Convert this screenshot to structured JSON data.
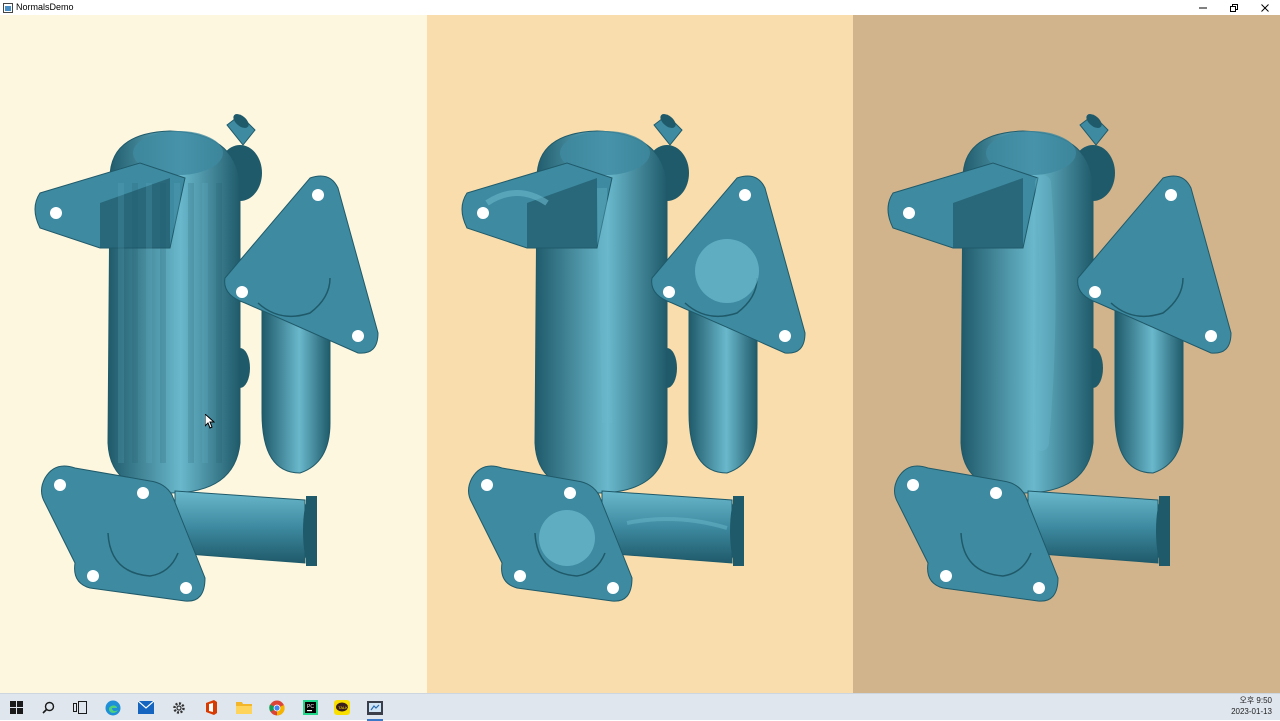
{
  "window": {
    "title": "NormalsDemo"
  },
  "panes": [
    {
      "name": "flat-shaded",
      "background": "#fef7e0"
    },
    {
      "name": "bumpy-normals",
      "background": "#f9ddac"
    },
    {
      "name": "smooth-normals",
      "background": "#d2b48c"
    }
  ],
  "colors": {
    "model": "#3e8aa0",
    "model_dark": "#1f5a6a",
    "model_light": "#6ab8cc",
    "taskbar": "#dfe6ee"
  },
  "taskbar": {
    "icons": [
      "windows-start",
      "search",
      "task-view",
      "edge",
      "mail",
      "settings",
      "office",
      "file-explorer",
      "chrome",
      "pycharm",
      "kakaotalk",
      "normalsdemo-app"
    ],
    "active": "normalsdemo-app"
  },
  "tray": {
    "time": "오후 9:50",
    "date": "2023-01-13"
  }
}
